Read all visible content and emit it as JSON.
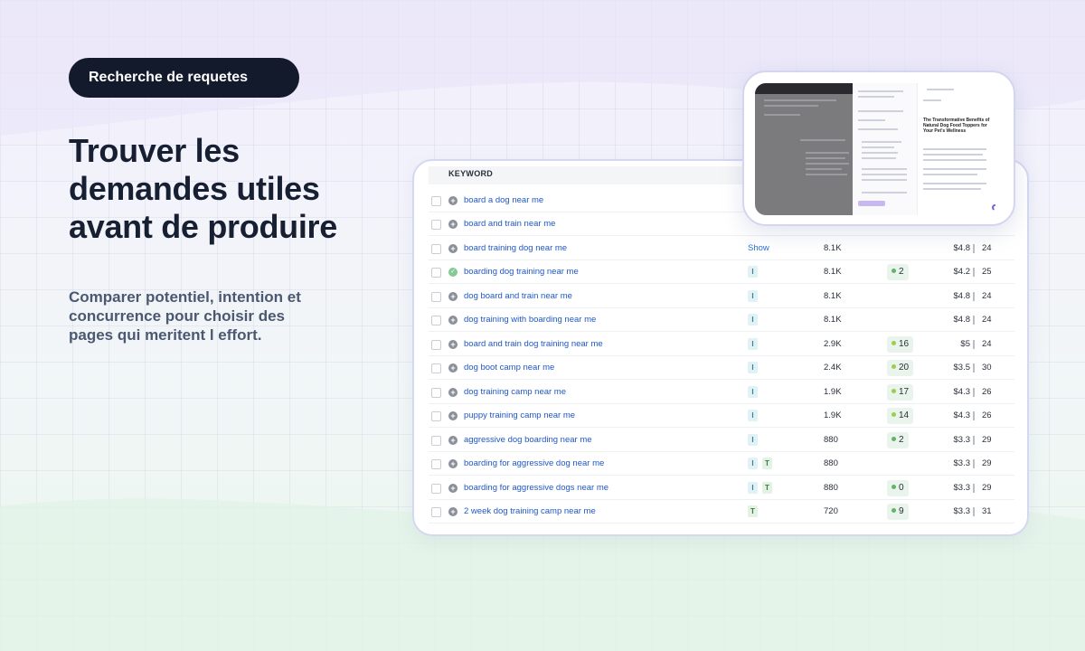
{
  "badge": "Recherche de requetes",
  "headline": "Trouver les demandes utiles avant de produire",
  "subtitle": "Comparer potentiel, intention et concurrence pour choisir des pages qui meritent l effort.",
  "table": {
    "keyword_header": "KEYWORD",
    "rows": [
      {
        "keyword": "board a dog near me",
        "intents": [],
        "show": "",
        "volume": "",
        "kd": "",
        "cpc": "",
        "competition": ""
      },
      {
        "keyword": "board and train near me",
        "intents": [],
        "show": "",
        "volume": "",
        "kd": "",
        "cpc": "",
        "competition": ""
      },
      {
        "keyword": "board training dog near me",
        "intents": [],
        "show": "Show",
        "volume": "8.1K",
        "kd": "",
        "cpc": "$4.8",
        "competition": "24"
      },
      {
        "keyword": "boarding dog training near me",
        "intents": [
          "I"
        ],
        "show": "",
        "volume": "8.1K",
        "kd": "2",
        "cpc": "$4.2",
        "competition": "25",
        "checked": true
      },
      {
        "keyword": "dog board and train near me",
        "intents": [
          "I"
        ],
        "show": "",
        "volume": "8.1K",
        "kd": "",
        "cpc": "$4.8",
        "competition": "24"
      },
      {
        "keyword": "dog training with boarding near me",
        "intents": [
          "I"
        ],
        "show": "",
        "volume": "8.1K",
        "kd": "",
        "cpc": "$4.8",
        "competition": "24"
      },
      {
        "keyword": "board and train dog training near me",
        "intents": [
          "I"
        ],
        "show": "",
        "volume": "2.9K",
        "kd": "16",
        "cpc": "$5",
        "competition": "24"
      },
      {
        "keyword": "dog boot camp near me",
        "intents": [
          "I"
        ],
        "show": "",
        "volume": "2.4K",
        "kd": "20",
        "cpc": "$3.5",
        "competition": "30"
      },
      {
        "keyword": "dog training camp near me",
        "intents": [
          "I"
        ],
        "show": "",
        "volume": "1.9K",
        "kd": "17",
        "cpc": "$4.3",
        "competition": "26"
      },
      {
        "keyword": "puppy training camp near me",
        "intents": [
          "I"
        ],
        "show": "",
        "volume": "1.9K",
        "kd": "14",
        "cpc": "$4.3",
        "competition": "26"
      },
      {
        "keyword": "aggressive dog boarding near me",
        "intents": [
          "I"
        ],
        "show": "",
        "volume": "880",
        "kd": "2",
        "cpc": "$3.3",
        "competition": "29"
      },
      {
        "keyword": "boarding for aggressive dog near me",
        "intents": [
          "I",
          "T"
        ],
        "show": "",
        "volume": "880",
        "kd": "",
        "cpc": "$3.3",
        "competition": "29"
      },
      {
        "keyword": "boarding for aggressive dogs near me",
        "intents": [
          "I",
          "T"
        ],
        "show": "",
        "volume": "880",
        "kd": "0",
        "cpc": "$3.3",
        "competition": "29"
      },
      {
        "keyword": "2 week dog training camp near me",
        "intents": [
          "T"
        ],
        "show": "",
        "volume": "720",
        "kd": "9",
        "cpc": "$3.3",
        "competition": "31"
      }
    ]
  },
  "preview": {
    "article_title": "The Transformative Benefits of Natural Dog Food Toppers for Your Pet's Wellness"
  },
  "colors": {
    "badge_bg": "#131a2b",
    "headline": "#172033",
    "subtitle": "#4b5872",
    "link": "#1f57c7",
    "accent": "#7b5bd6"
  }
}
